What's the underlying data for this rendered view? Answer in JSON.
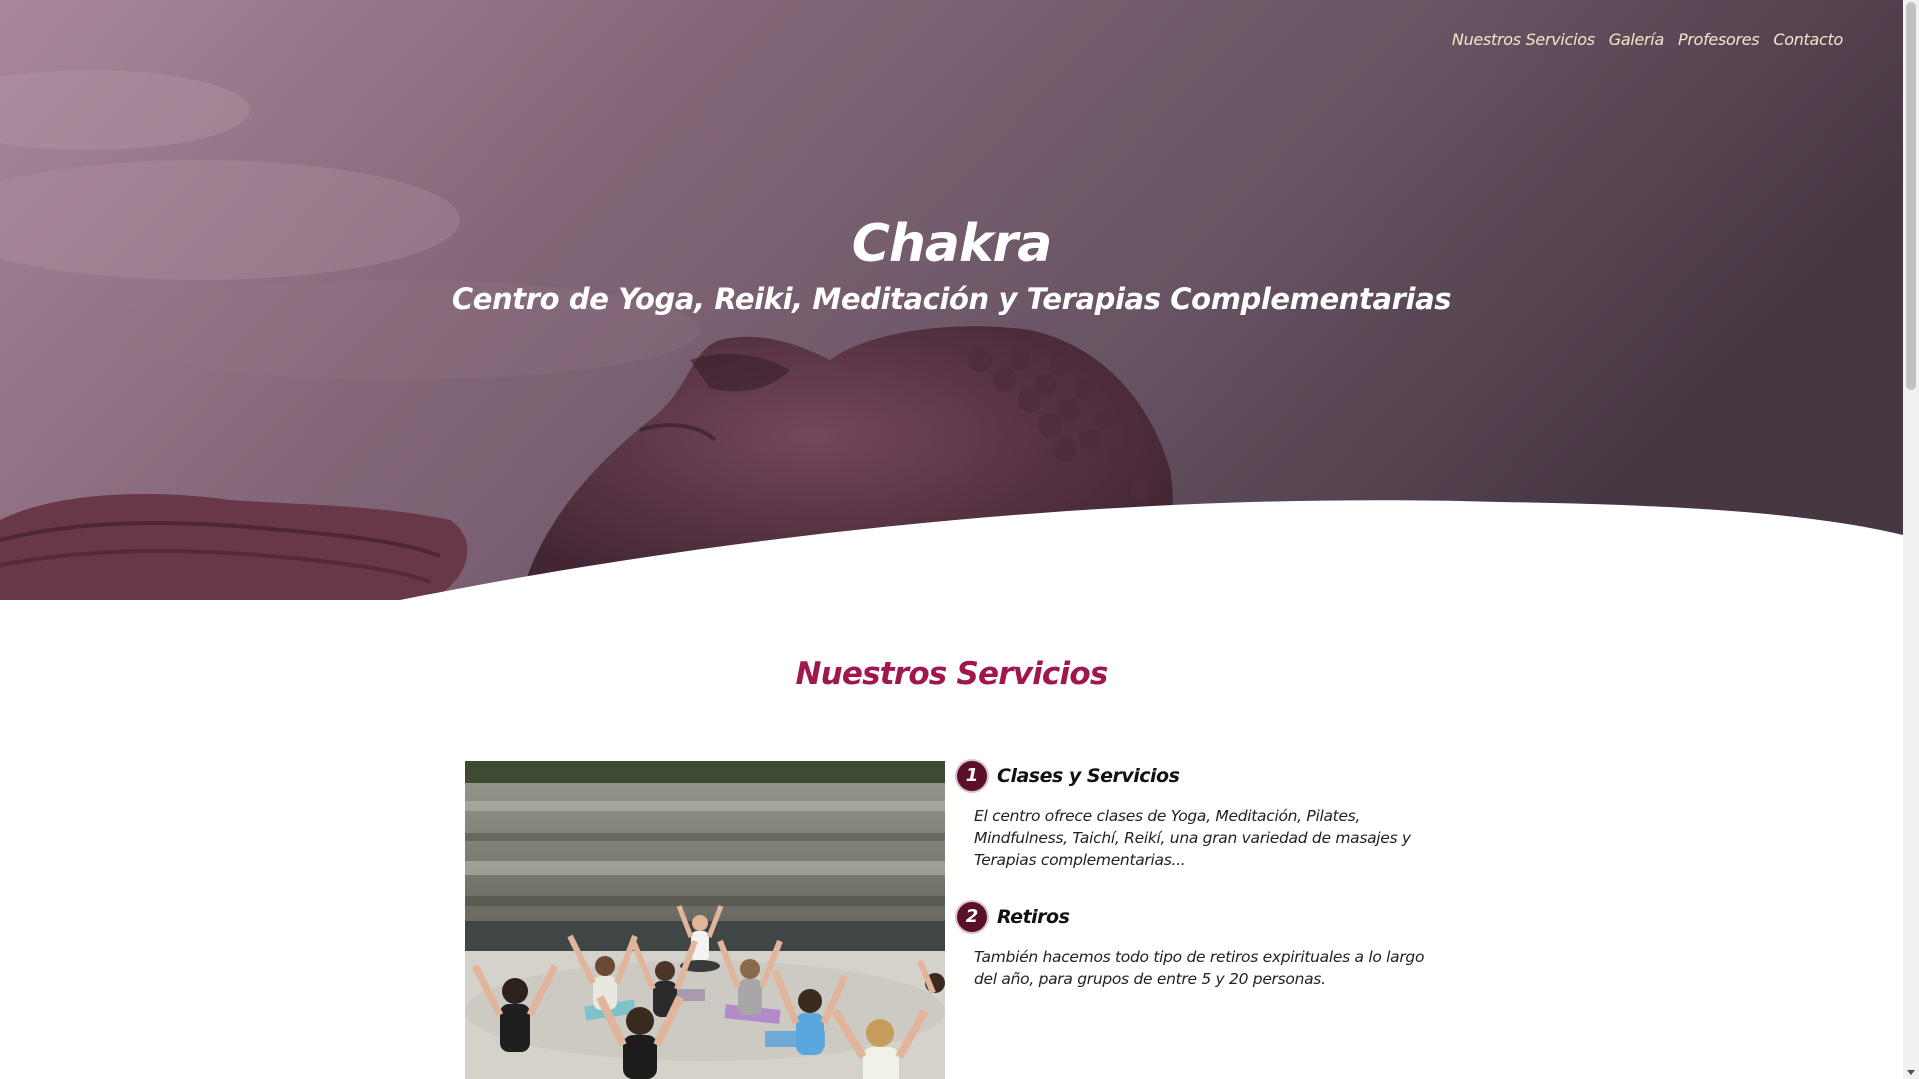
{
  "nav": {
    "items": [
      "Nuestros Servicios",
      "Galería",
      "Profesores",
      "Contacto"
    ]
  },
  "hero": {
    "title": "Chakra",
    "subtitle": "Centro de Yoga, Reiki, Meditación y Terapias Complementarias"
  },
  "services": {
    "title": "Nuestros Servicios",
    "items": [
      {
        "number": "1",
        "title": "Clases y Servicios",
        "text": "El centro ofrece clases de Yoga, Meditación, Pilates, Mindfulness, Taichí, Reikí, una gran variedad de masajes y Terapias complementarias..."
      },
      {
        "number": "2",
        "title": "Retiros",
        "text": "También hacemos todo tipo de retiros expirituales a lo largo del año, para grupos de entre 5 y 20 personas."
      }
    ]
  },
  "colors": {
    "accent": "#a0174f",
    "badge": "#5a1029",
    "nav_text": "#f3e6c8"
  }
}
